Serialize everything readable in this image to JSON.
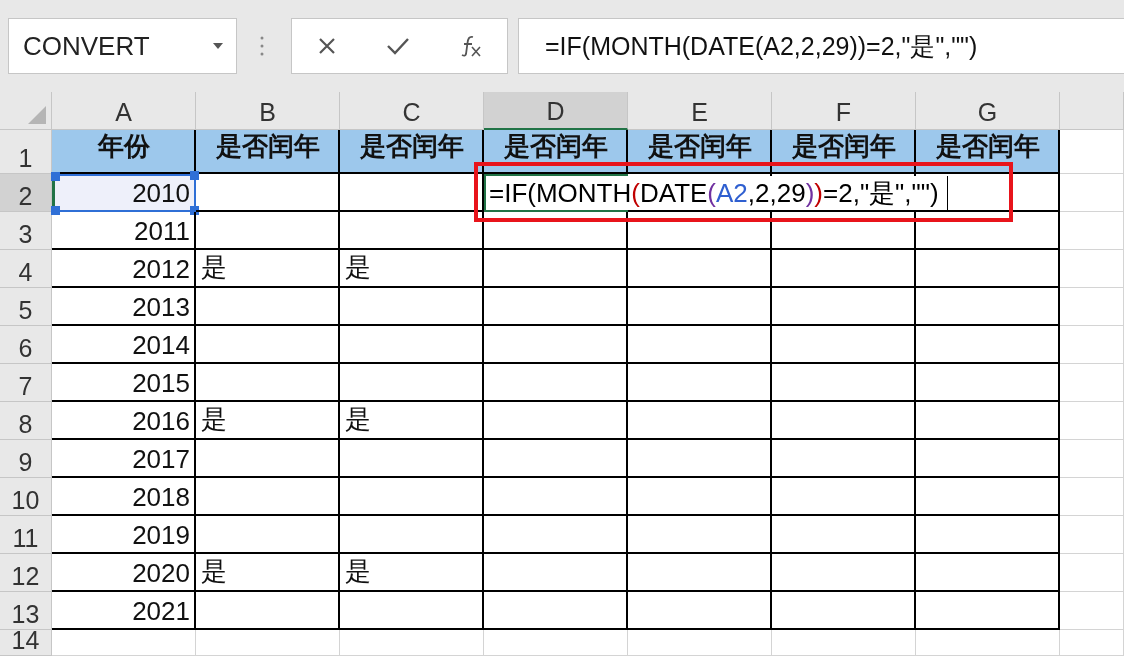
{
  "name_box": {
    "value": "CONVERT"
  },
  "formula_bar": {
    "formula": "=IF(MONTH(DATE(A2,2,29))=2,\"是\",\"\")"
  },
  "columns": [
    {
      "label": "A",
      "selected": false
    },
    {
      "label": "B",
      "selected": false
    },
    {
      "label": "C",
      "selected": false
    },
    {
      "label": "D",
      "selected": true
    },
    {
      "label": "E",
      "selected": false
    },
    {
      "label": "F",
      "selected": false
    },
    {
      "label": "G",
      "selected": false
    }
  ],
  "rows": [
    {
      "number": "1",
      "selected": false,
      "kind": "header",
      "cells": [
        "年份",
        "是否闰年",
        "是否闰年",
        "是否闰年",
        "是否闰年",
        "是否闰年",
        "是否闰年"
      ]
    },
    {
      "number": "2",
      "selected": true,
      "kind": "data",
      "cells": [
        {
          "text": "2010",
          "referenced": true
        },
        null,
        null,
        {
          "editing": true,
          "segments": [
            {
              "text": "=IF(MONTH",
              "color": "#000000"
            },
            {
              "text": "(",
              "color": "#c00000"
            },
            {
              "text": "DATE",
              "color": "#000000"
            },
            {
              "text": "(",
              "color": "#7030a0"
            },
            {
              "text": "A2",
              "color": "#2f5fd0"
            },
            {
              "text": ",2,29",
              "color": "#000000"
            },
            {
              "text": ")",
              "color": "#7030a0"
            },
            {
              "text": ")",
              "color": "#c00000"
            },
            {
              "text": "=2,\"是\",\"\")",
              "color": "#000000"
            }
          ]
        },
        null,
        null,
        null
      ]
    },
    {
      "number": "3",
      "selected": false,
      "kind": "data",
      "cells": [
        "2011",
        null,
        null,
        null,
        null,
        null,
        null
      ]
    },
    {
      "number": "4",
      "selected": false,
      "kind": "data",
      "cells": [
        "2012",
        "是",
        "是",
        null,
        null,
        null,
        null
      ]
    },
    {
      "number": "5",
      "selected": false,
      "kind": "data",
      "cells": [
        "2013",
        null,
        null,
        null,
        null,
        null,
        null
      ]
    },
    {
      "number": "6",
      "selected": false,
      "kind": "data",
      "cells": [
        "2014",
        null,
        null,
        null,
        null,
        null,
        null
      ]
    },
    {
      "number": "7",
      "selected": false,
      "kind": "data",
      "cells": [
        "2015",
        null,
        null,
        null,
        null,
        null,
        null
      ]
    },
    {
      "number": "8",
      "selected": false,
      "kind": "data",
      "cells": [
        "2016",
        "是",
        "是",
        null,
        null,
        null,
        null
      ]
    },
    {
      "number": "9",
      "selected": false,
      "kind": "data",
      "cells": [
        "2017",
        null,
        null,
        null,
        null,
        null,
        null
      ]
    },
    {
      "number": "10",
      "selected": false,
      "kind": "data",
      "cells": [
        "2018",
        null,
        null,
        null,
        null,
        null,
        null
      ]
    },
    {
      "number": "11",
      "selected": false,
      "kind": "data",
      "cells": [
        "2019",
        null,
        null,
        null,
        null,
        null,
        null
      ]
    },
    {
      "number": "12",
      "selected": false,
      "kind": "data",
      "cells": [
        "2020",
        "是",
        "是",
        null,
        null,
        null,
        null
      ]
    },
    {
      "number": "13",
      "selected": false,
      "kind": "data",
      "cells": [
        "2021",
        null,
        null,
        null,
        null,
        null,
        null
      ]
    },
    {
      "number": "14",
      "selected": false,
      "kind": "blank",
      "cells": [
        null,
        null,
        null,
        null,
        null,
        null,
        null
      ]
    }
  ],
  "highlight_box": true
}
